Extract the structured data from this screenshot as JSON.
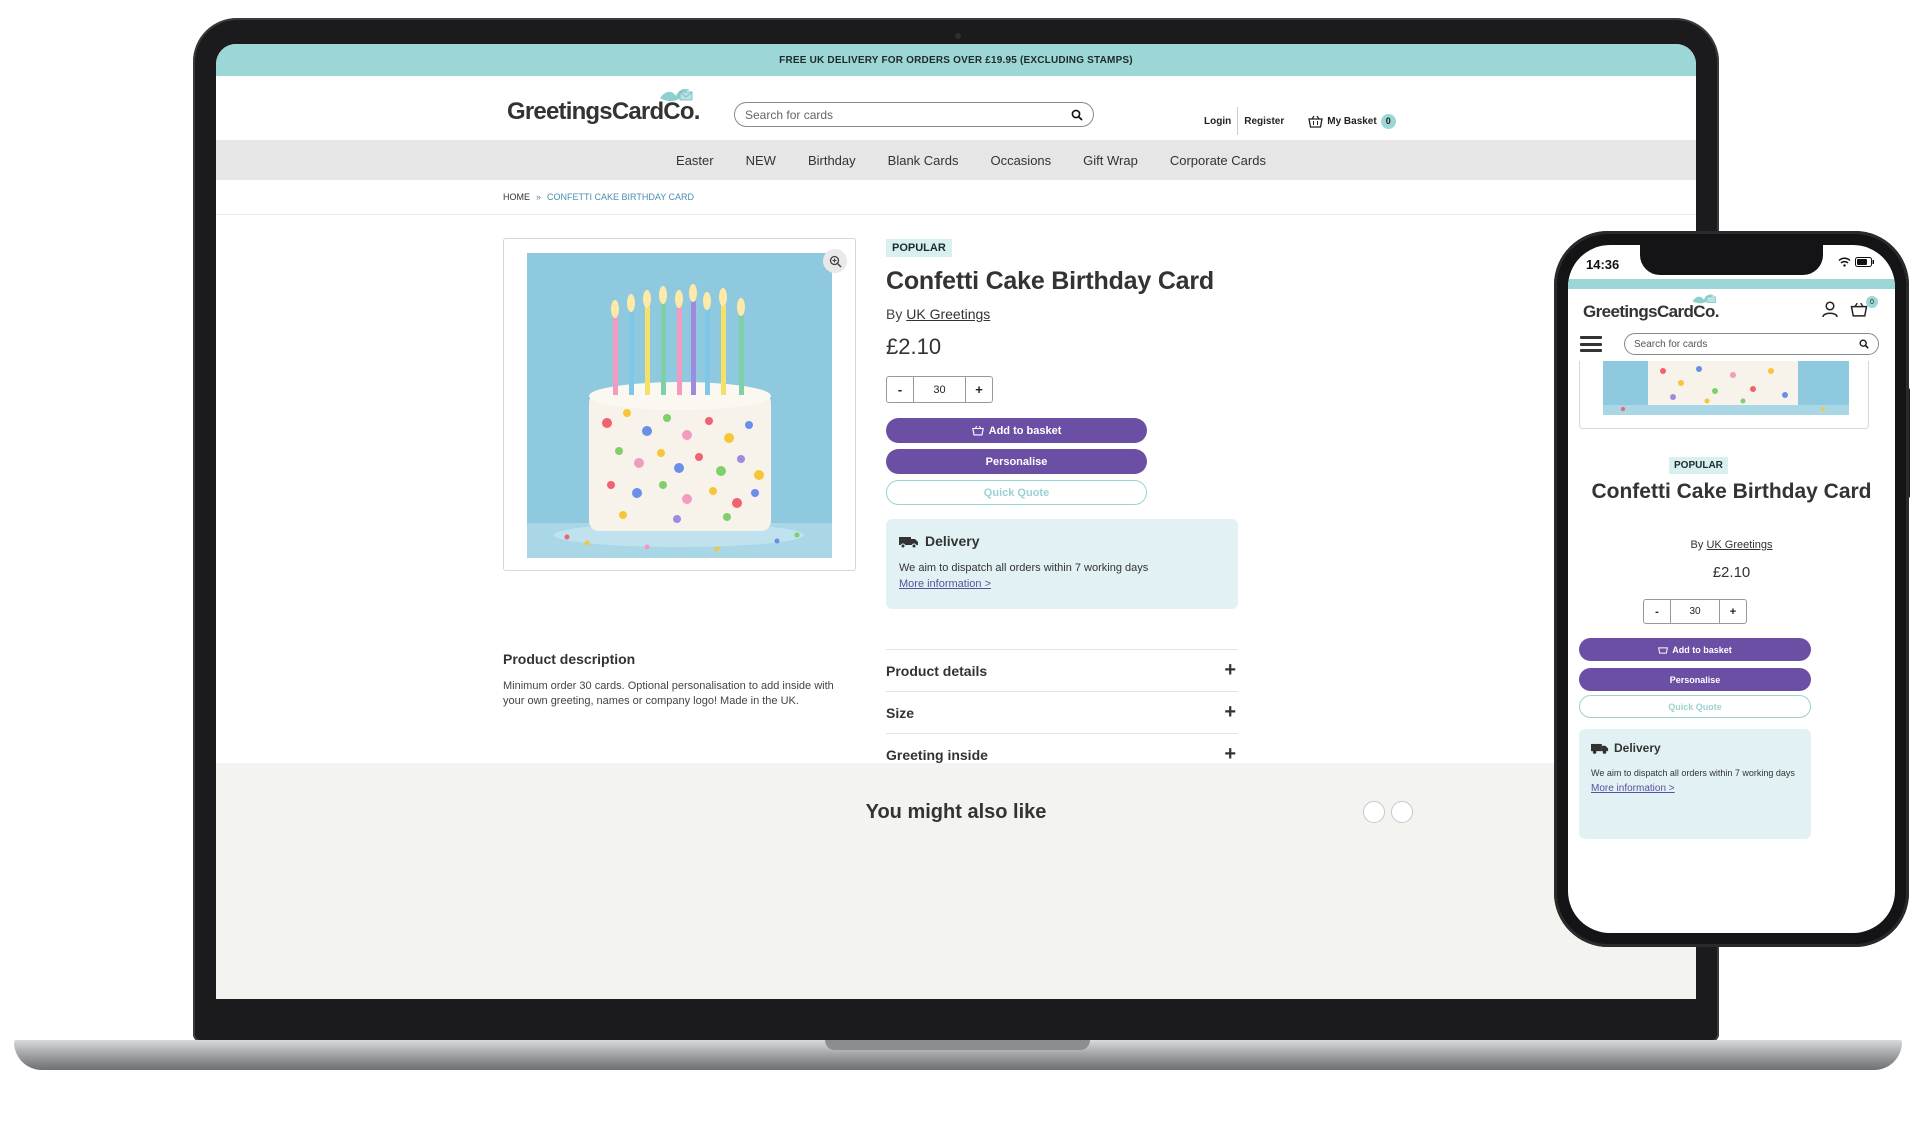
{
  "desktop": {
    "promo": "FREE UK DELIVERY FOR ORDERS OVER £19.95 (EXCLUDING STAMPS)",
    "logo": "GreetingsCardCo.",
    "search_placeholder": "Search for cards",
    "login": "Login",
    "register": "Register",
    "basket_label": "My Basket",
    "basket_count": "0",
    "nav": [
      "Easter",
      "NEW",
      "Birthday",
      "Blank Cards",
      "Occasions",
      "Gift Wrap",
      "Corporate Cards"
    ],
    "breadcrumb": {
      "home": "HOME",
      "sep": "»",
      "current": "CONFETTI CAKE BIRTHDAY CARD"
    },
    "product": {
      "tag": "POPULAR",
      "title": "Confetti Cake Birthday Card",
      "by_prefix": "By",
      "brand": "UK Greetings",
      "price": "£2.10",
      "qty_minus": "-",
      "qty": "30",
      "qty_plus": "+",
      "add_to_basket": "Add to basket",
      "personalise": "Personalise",
      "quick_quote": "Quick Quote"
    },
    "delivery": {
      "title": "Delivery",
      "text": "We aim to dispatch all orders within 7 working days",
      "link": "More information >"
    },
    "description": {
      "heading": "Product description",
      "text": "Minimum order 30 cards. Optional personalisation to add inside with your own greeting, names or company logo! Made in the UK."
    },
    "accordion": [
      "Product details",
      "Size",
      "Greeting inside"
    ],
    "accordion_icon": "+",
    "related_heading": "You might also like"
  },
  "mobile": {
    "time": "14:36",
    "logo": "GreetingsCardCo.",
    "cart_count": "0",
    "search_placeholder": "Search for cards",
    "tag": "POPULAR",
    "title": "Confetti Cake Birthday Card",
    "by_prefix": "By",
    "brand": "UK Greetings",
    "price": "£2.10",
    "qty_minus": "-",
    "qty": "30",
    "qty_plus": "+",
    "add_to_basket": "Add to basket",
    "personalise": "Personalise",
    "quick_quote": "Quick Quote",
    "delivery_title": "Delivery",
    "delivery_text": "We aim to dispatch all orders within 7 working days",
    "delivery_link": "More information >"
  },
  "colors": {
    "teal": "#9cd6d6",
    "purple": "#6a4fa4",
    "delivery_bg": "#e2f2f4",
    "nav_bg": "#e6e6e6"
  },
  "icons": [
    "search-icon",
    "basket-icon",
    "zoom-icon",
    "truck-icon",
    "user-icon",
    "menu-icon",
    "bird-logo-icon",
    "wifi-icon",
    "battery-icon"
  ]
}
